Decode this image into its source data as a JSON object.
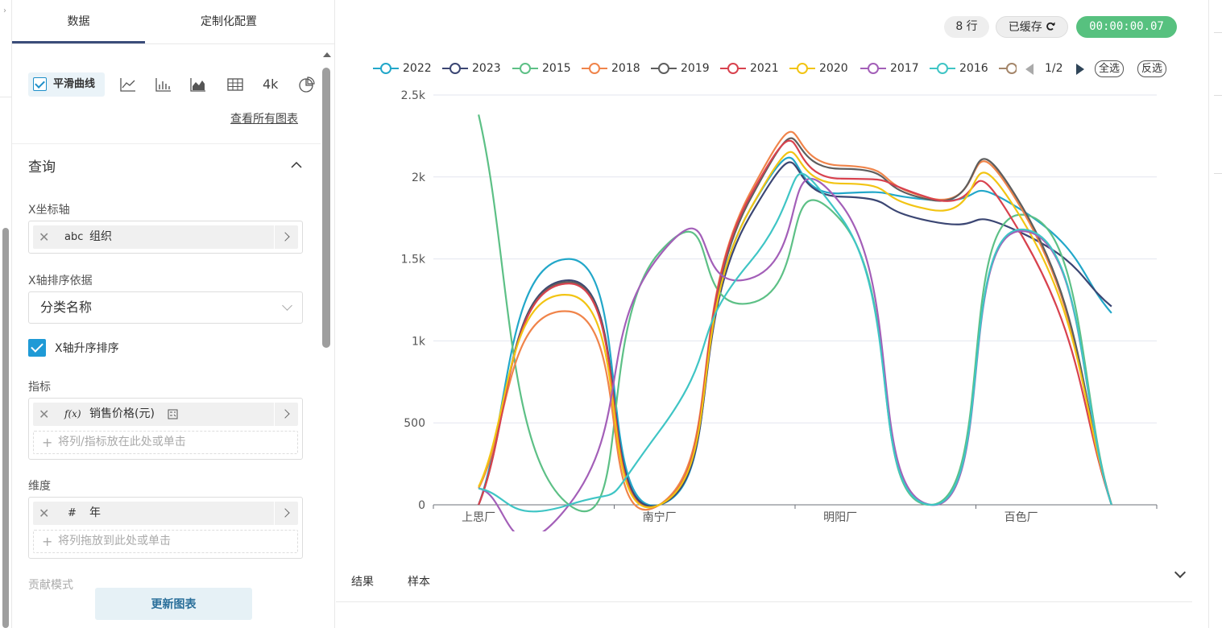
{
  "panel": {
    "tabs": [
      "数据",
      "定制化配置"
    ],
    "smooth_label": "平滑曲线",
    "viz_4k": "4k",
    "viz_icons": [
      "line-chart-icon",
      "bar-chart-icon",
      "area-chart-icon",
      "table-icon",
      "pie-chart-icon"
    ],
    "all_charts": "查看所有图表",
    "query_title": "查询",
    "x_axis_label": "X坐标轴",
    "x_axis_pill": {
      "type": "abc",
      "name": "组织"
    },
    "x_sort_label": "X轴排序依据",
    "x_sort_value": "分类名称",
    "x_asc_label": "X轴升序排序",
    "metric_label": "指标",
    "metric_pill": {
      "type": "f(x)",
      "name": "销售价格(元)"
    },
    "metric_hint": "将列/指标放在此处或单击",
    "dimension_label": "维度",
    "dimension_pill": {
      "type": "#",
      "name": "年"
    },
    "dimension_hint": "将列拖放到此处或单击",
    "contrib_label": "贡献模式",
    "update_button": "更新图表"
  },
  "header": {
    "rows": "8 行",
    "cache": "已缓存",
    "timer": "00:00:00.07"
  },
  "legend": {
    "page": "1/2",
    "select_all": "全选",
    "invert": "反选"
  },
  "bottom_tabs": [
    "结果",
    "样本"
  ],
  "chart_data": {
    "type": "line",
    "smooth": true,
    "categories": [
      "上思厂",
      "",
      "南宁厂",
      "",
      "明阳厂",
      "",
      "百色厂",
      ""
    ],
    "x_tick_labels": [
      "上思厂",
      "南宁厂",
      "明阳厂",
      "百色厂"
    ],
    "ylim": [
      0,
      2500
    ],
    "y_ticks": [
      0,
      500,
      1000,
      1500,
      2000,
      2500
    ],
    "y_tick_labels": [
      "0",
      "500",
      "1k",
      "1.5k",
      "2k",
      "2.5k"
    ],
    "grid": true,
    "legend_position": "top",
    "series": [
      {
        "name": "2022",
        "color": "#22a7c9",
        "values": [
          0,
          1500,
          0,
          1800,
          1900,
          1860,
          1800,
          1170
        ]
      },
      {
        "name": "2023",
        "color": "#3b4673",
        "values": [
          0,
          1370,
          0,
          1760,
          1880,
          1730,
          1660,
          1210
        ]
      },
      {
        "name": "2015",
        "color": "#5dc086",
        "values": [
          2380,
          0,
          1540,
          1230,
          1740,
          0,
          1770,
          0
        ]
      },
      {
        "name": "2018",
        "color": "#f0844a",
        "values": [
          100,
          1180,
          0,
          1900,
          2070,
          1870,
          1810,
          0
        ]
      },
      {
        "name": "2019",
        "color": "#5e5e5e",
        "values": [
          0,
          1360,
          0,
          1860,
          2050,
          1860,
          1830,
          0
        ]
      },
      {
        "name": "2021",
        "color": "#d8424e",
        "values": [
          0,
          1350,
          0,
          1880,
          1990,
          1870,
          1650,
          0
        ]
      },
      {
        "name": "2020",
        "color": "#f2c413",
        "values": [
          110,
          1280,
          0,
          1800,
          1960,
          1800,
          1750,
          0
        ]
      },
      {
        "name": "2017",
        "color": "#a35fb8",
        "values": [
          100,
          0,
          1520,
          1380,
          1840,
          0,
          1670,
          0
        ]
      },
      {
        "name": "2016",
        "color": "#3fc5c5",
        "values": [
          100,
          0,
          450,
          1480,
          1760,
          0,
          1680,
          0
        ]
      },
      {
        "name": "",
        "color": "#a4866a",
        "values": []
      }
    ]
  }
}
